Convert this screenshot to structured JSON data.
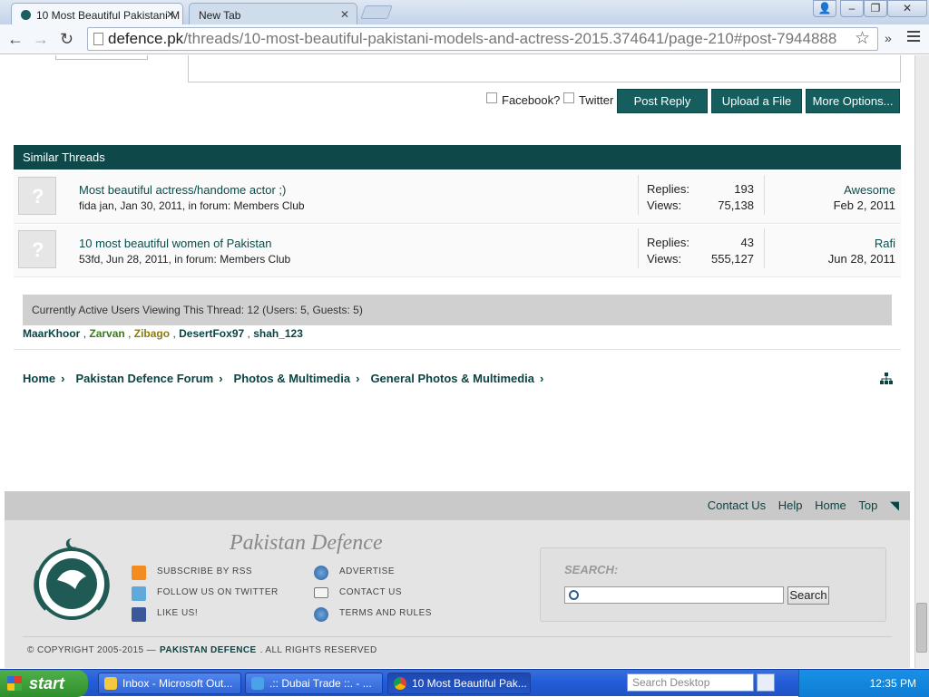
{
  "browser": {
    "tabs": [
      {
        "label": "10 Most Beautiful Pakistani M",
        "active": true
      },
      {
        "label": "New Tab",
        "active": false
      }
    ],
    "url_host": "defence.pk",
    "url_path": "/threads/10-most-beautiful-pakistani-models-and-actress-2015.374641/page-210#post-7944888",
    "window_buttons": {
      "user": "👤",
      "minimize": "–",
      "maximize": "❐",
      "close": "✕"
    }
  },
  "reply_bar": {
    "facebook_label": "Facebook?",
    "twitter_label": "Twitter",
    "post_reply": "Post Reply",
    "upload": "Upload a File",
    "more": "More Options..."
  },
  "similar_threads": {
    "title": "Similar Threads",
    "threads": [
      {
        "title": "Most beautiful actress/handome actor ;)",
        "meta": "fida jan, Jan 30, 2011, in forum: Members Club",
        "replies_label": "Replies:",
        "replies": "193",
        "views_label": "Views:",
        "views": "75,138",
        "last_user": "Awesome",
        "last_date": "Feb 2, 2011"
      },
      {
        "title": "10 most beautiful women of Pakistan",
        "meta": "53fd, Jun 28, 2011, in forum: Members Club",
        "replies_label": "Replies:",
        "replies": "43",
        "views_label": "Views:",
        "views": "555,127",
        "last_user": "Rafi",
        "last_date": "Jun 28, 2011"
      }
    ]
  },
  "active_users": {
    "text": "Currently Active Users Viewing This Thread: 12 (Users: 5, Guests: 5)",
    "users": [
      {
        "name": "MaarKhoor",
        "color": "#0a4444"
      },
      {
        "name": "Zarvan",
        "color": "#3b7a1e"
      },
      {
        "name": "Zibago",
        "color": "#8a7a10"
      },
      {
        "name": "DesertFox97",
        "color": "#0a4444"
      },
      {
        "name": "shah_123",
        "color": "#0a4444"
      }
    ],
    "separator": ","
  },
  "breadcrumb": [
    "Home",
    "Pakistan Defence Forum",
    "Photos & Multimedia",
    "General Photos & Multimedia"
  ],
  "footer": {
    "links": [
      "Contact Us",
      "Help",
      "Home",
      "Top"
    ],
    "brand": "Pakistan Defence",
    "logo_text": "PAKISTAN DEFENCE",
    "col1": [
      "SUBSCRIBE BY RSS",
      "FOLLOW US ON TWITTER",
      "LIKE US!"
    ],
    "col2": [
      "ADVERTISE",
      "CONTACT US",
      "TERMS AND RULES"
    ],
    "search_label": "SEARCH:",
    "search_button": "Search",
    "copyright_pre": "© COPYRIGHT 2005-2015 —",
    "copyright_brand": "PAKISTAN DEFENCE",
    "copyright_post": ". ALL RIGHTS RESERVED"
  },
  "taskbar": {
    "start": "start",
    "tasks": [
      "Inbox - Microsoft Out...",
      ".:: Dubai Trade ::. - ...",
      "10 Most Beautiful Pak..."
    ],
    "search_placeholder": "Search Desktop",
    "clock": "12:35 PM"
  },
  "colors": {
    "accent": "#165d5d",
    "header": "#0f4848",
    "link": "#0a4c4c"
  }
}
